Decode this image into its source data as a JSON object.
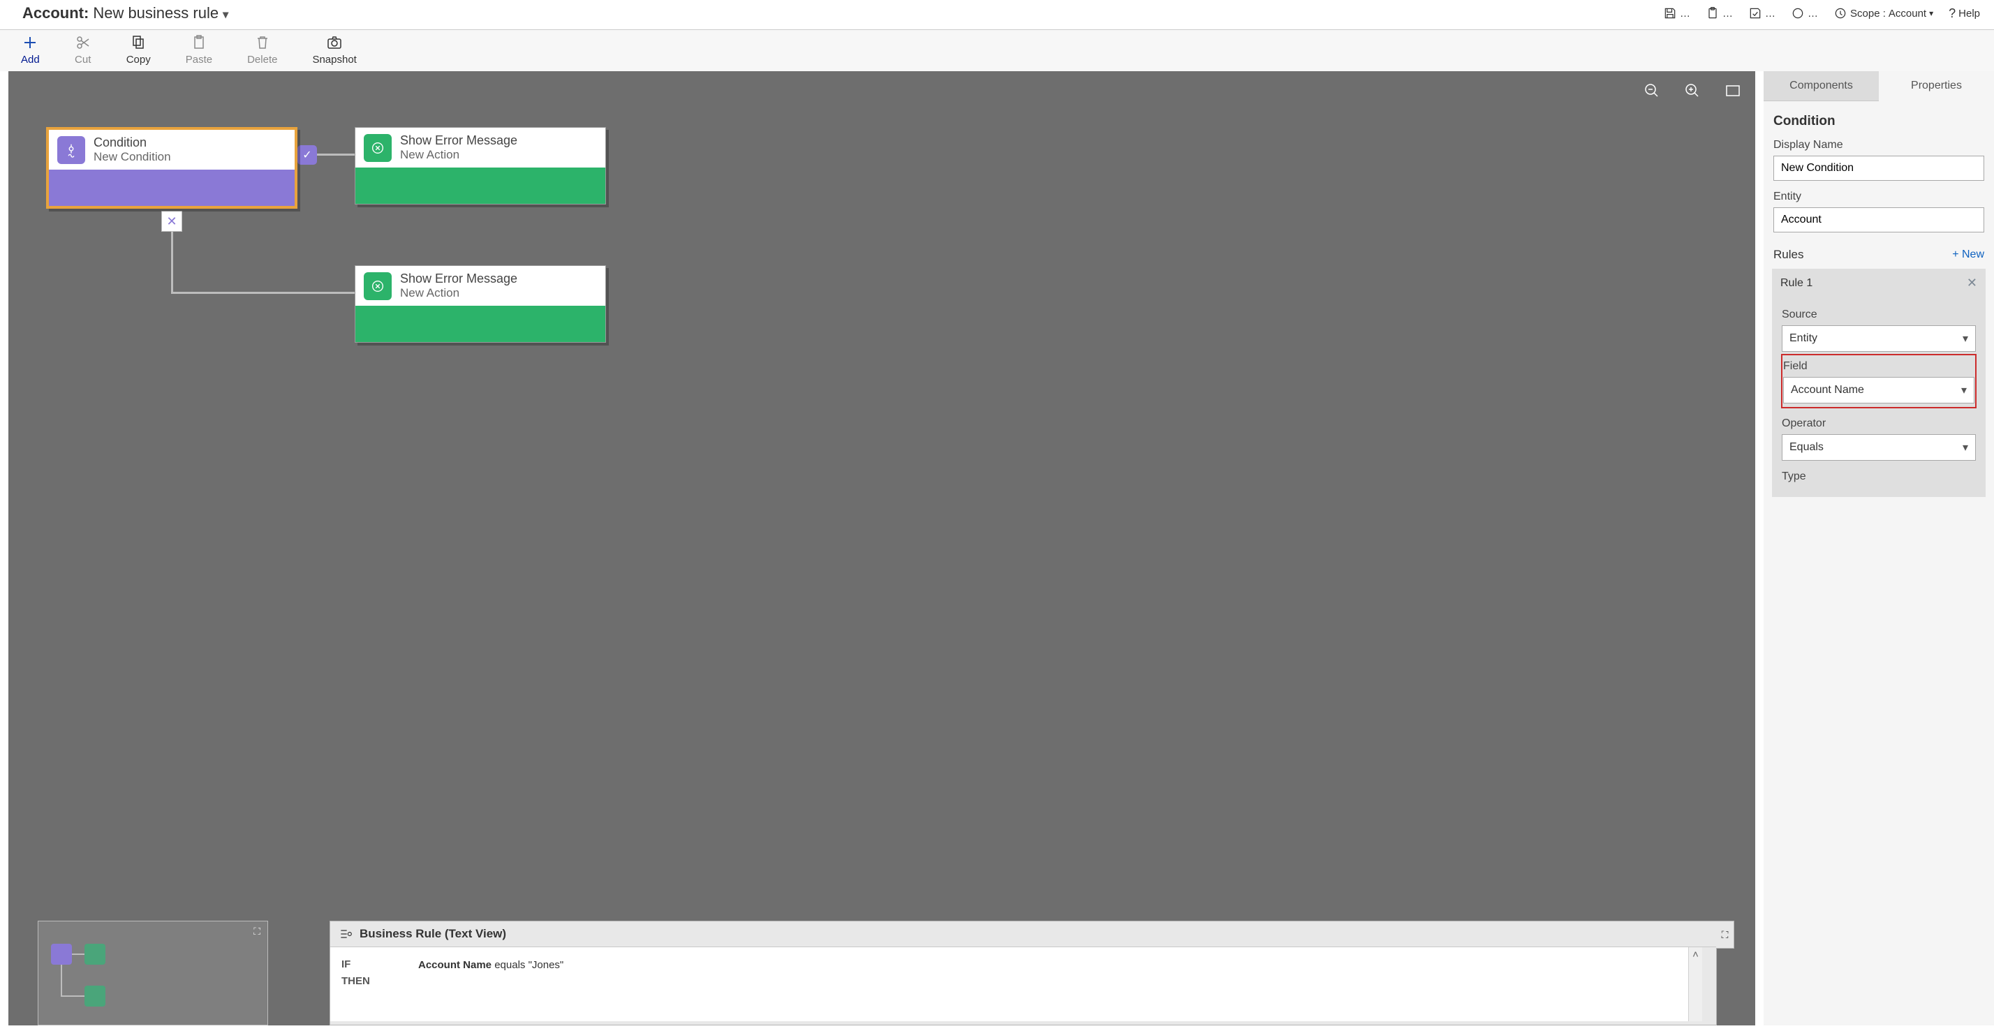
{
  "header": {
    "entity": "Account:",
    "rule_name": "New business rule",
    "scope_label": "Scope :",
    "scope_value": "Account",
    "help": "Help"
  },
  "toolbar": {
    "add": "Add",
    "cut": "Cut",
    "copy": "Copy",
    "paste": "Paste",
    "delete": "Delete",
    "snapshot": "Snapshot"
  },
  "nodes": {
    "condition": {
      "title": "Condition",
      "subtitle": "New Condition"
    },
    "action1": {
      "title": "Show Error Message",
      "subtitle": "New Action"
    },
    "action2": {
      "title": "Show Error Message",
      "subtitle": "New Action"
    }
  },
  "textview": {
    "heading": "Business Rule (Text View)",
    "if_kw": "IF",
    "then_kw": "THEN",
    "cond_field": "Account Name",
    "cond_rest": " equals \"Jones\""
  },
  "panel": {
    "tab_components": "Components",
    "tab_properties": "Properties",
    "section_title": "Condition",
    "display_name_label": "Display Name",
    "display_name_value": "New Condition",
    "entity_label": "Entity",
    "entity_value": "Account",
    "rules_label": "Rules",
    "new_label": "+  New",
    "rule1_label": "Rule 1",
    "source_label": "Source",
    "source_value": "Entity",
    "field_label": "Field",
    "field_value": "Account Name",
    "operator_label": "Operator",
    "operator_value": "Equals",
    "type_label": "Type"
  }
}
